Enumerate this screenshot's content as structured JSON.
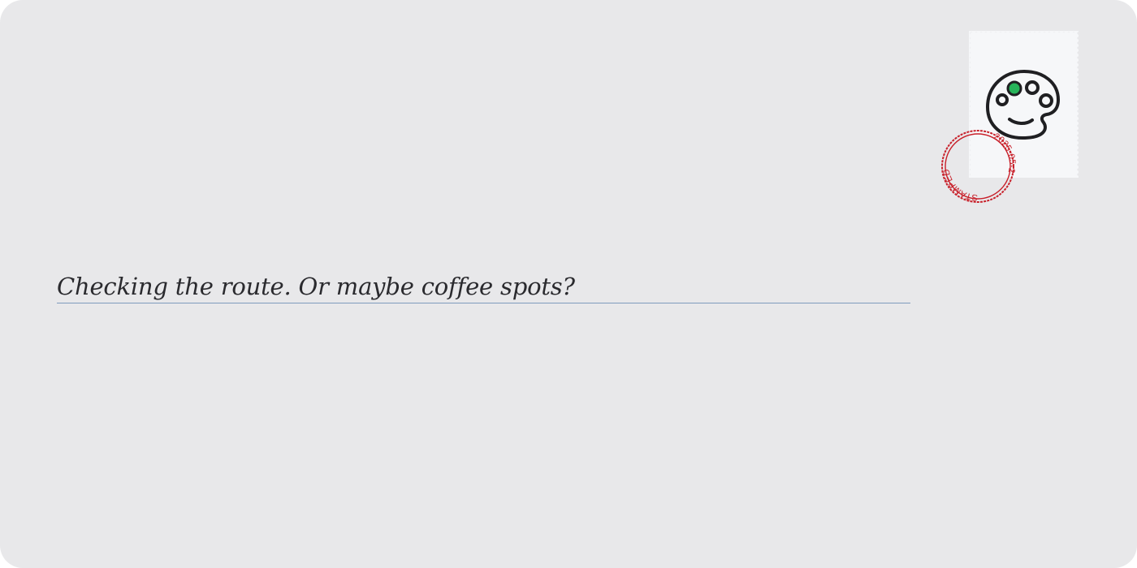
{
  "message": {
    "text": "Checking the route. Or maybe coffee spots?"
  },
  "stamp": {
    "icon": "palette-icon",
    "colors": {
      "paper": "#f6f7f9",
      "outline": "#1f1f22",
      "accent_dot": "#27b45a"
    }
  },
  "postmark": {
    "label": "STAMPED",
    "date": "2025-05-2",
    "color": "#c8202a"
  },
  "theme": {
    "background": "#e8e8ea",
    "underline": "#7e9bbd"
  }
}
